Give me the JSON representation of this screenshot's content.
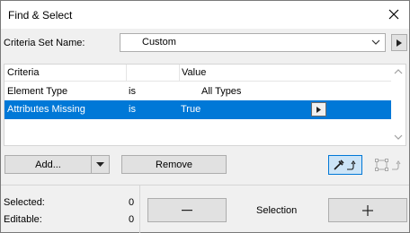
{
  "window": {
    "title": "Find & Select"
  },
  "criteria_set": {
    "label": "Criteria Set Name:",
    "value": "Custom"
  },
  "table": {
    "columns": [
      "Criteria",
      "Value"
    ],
    "rows": [
      {
        "criteria": "Element Type",
        "operator": "is",
        "value": "All Types"
      },
      {
        "criteria": "Attributes Missing",
        "operator": "is",
        "value": "True"
      }
    ]
  },
  "buttons": {
    "add": "Add...",
    "remove": "Remove",
    "selection": "Selection"
  },
  "status": {
    "selected_label": "Selected:",
    "selected_value": "0",
    "editable_label": "Editable:",
    "editable_value": "0"
  },
  "colors": {
    "selection_highlight": "#0078d7",
    "dialog_bg": "#f0f0f0"
  }
}
